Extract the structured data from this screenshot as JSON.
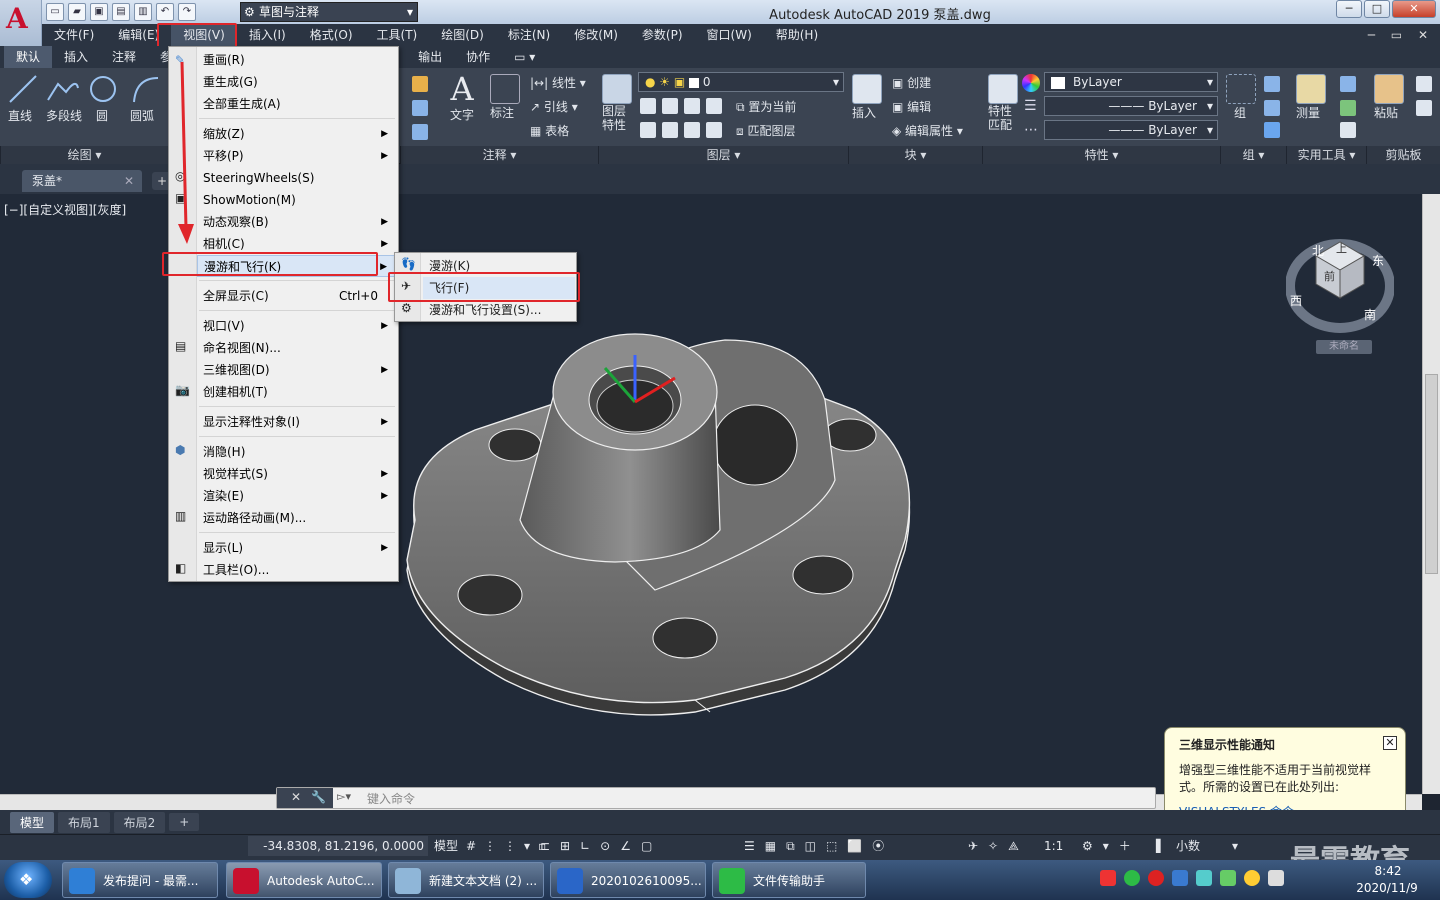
{
  "window": {
    "title": "Autodesk AutoCAD 2019    泵盖.dwg",
    "workspace": "草图与注释"
  },
  "menubar": [
    "文件(F)",
    "编辑(E)",
    "视图(V)",
    "插入(I)",
    "格式(O)",
    "工具(T)",
    "绘图(D)",
    "标注(N)",
    "修改(M)",
    "参数(P)",
    "窗口(W)",
    "帮助(H)"
  ],
  "ribbon_tabs": [
    "默认",
    "插入",
    "注释",
    "参数",
    "输出",
    "协作"
  ],
  "ribbon": {
    "draw": [
      "直线",
      "多段线",
      "圆",
      "圆弧"
    ],
    "draw_panel": "绘图 ▾",
    "annot": {
      "text": "文字",
      "dim": "标注",
      "linear": "线性",
      "leader": "引线",
      "table": "表格",
      "panel": "注释 ▾"
    },
    "layers": {
      "props": "图层特性",
      "current_layer": "0",
      "set_current": "置为当前",
      "match_layer": "匹配图层",
      "panel": "图层 ▾"
    },
    "block": {
      "insert": "插入",
      "create": "创建",
      "edit": "编辑",
      "edit_attr": "编辑属性",
      "panel": "块 ▾"
    },
    "properties": {
      "match": "特性匹配",
      "color": "ByLayer",
      "linetype": "ByLayer",
      "lineweight": "ByLayer",
      "panel": "特性 ▾"
    },
    "group": {
      "label": "组",
      "panel": "组 ▾"
    },
    "utilities": {
      "measure": "测量",
      "panel": "实用工具 ▾"
    },
    "clipboard": {
      "paste": "粘贴",
      "panel": "剪贴板"
    }
  },
  "doc_tab": "泵盖*",
  "viewport_label": "[−][自定义视图][灰度]",
  "viewcube": {
    "top": "上",
    "front": "前",
    "south": "南",
    "west": "西",
    "east": "东",
    "north": "北",
    "ucs": "未命名"
  },
  "view_menu": {
    "items": [
      {
        "label": "重画(R)"
      },
      {
        "label": "重生成(G)"
      },
      {
        "label": "全部重生成(A)"
      },
      {
        "label": "缩放(Z)",
        "sub": true
      },
      {
        "label": "平移(P)",
        "sub": true
      },
      {
        "label": "SteeringWheels(S)"
      },
      {
        "label": "ShowMotion(M)"
      },
      {
        "label": "动态观察(B)",
        "sub": true
      },
      {
        "label": "相机(C)",
        "sub": true
      },
      {
        "label": "漫游和飞行(K)",
        "sub": true
      },
      {
        "label": "全屏显示(C)",
        "shortcut": "Ctrl+0"
      },
      {
        "label": "视口(V)",
        "sub": true
      },
      {
        "label": "命名视图(N)..."
      },
      {
        "label": "三维视图(D)",
        "sub": true
      },
      {
        "label": "创建相机(T)"
      },
      {
        "label": "显示注释性对象(I)",
        "sub": true
      },
      {
        "label": "消隐(H)"
      },
      {
        "label": "视觉样式(S)",
        "sub": true
      },
      {
        "label": "渲染(E)",
        "sub": true
      },
      {
        "label": "运动路径动画(M)..."
      },
      {
        "label": "显示(L)",
        "sub": true
      },
      {
        "label": "工具栏(O)..."
      }
    ]
  },
  "walkfly_menu": [
    "漫游(K)",
    "飞行(F)",
    "漫游和飞行设置(S)..."
  ],
  "command_line": {
    "placeholder": "键入命令"
  },
  "layout_tabs": [
    "模型",
    "布局1",
    "布局2"
  ],
  "status": {
    "coords": "-34.8308, 81.2196, 0.0000",
    "mode": "模型",
    "scale": "1:1",
    "units": "小数"
  },
  "notification": {
    "title": "三维显示性能通知",
    "body": "增强型三维性能不适用于当前视觉样式。所需的设置已在此处列出:",
    "link": "VISUALSTYLES 命令"
  },
  "taskbar": [
    {
      "label": "发布提问 - 最需..."
    },
    {
      "label": "Autodesk AutoC..."
    },
    {
      "label": "新建文本文档 (2) ..."
    },
    {
      "label": "2020102610095..."
    },
    {
      "label": "文件传输助手"
    }
  ],
  "tray": {
    "time": "8:42",
    "date": "2020/11/9"
  },
  "watermark": "最需教育",
  "colors": {
    "highlight_box": "#e0262b",
    "ribbon_bg": "#3b4452",
    "viewport_bg": "#212a38"
  }
}
